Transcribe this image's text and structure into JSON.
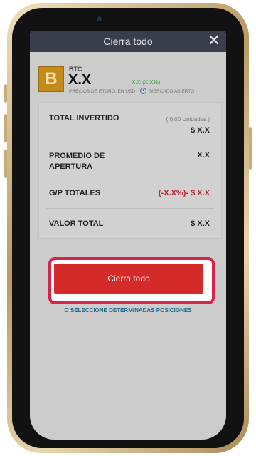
{
  "header": {
    "title": "Cierra todo",
    "close_icon": "close-icon"
  },
  "asset": {
    "symbol": "BTC",
    "logo_letter": "B",
    "price": "X.X",
    "change": "X.X (X.X%)",
    "note_prices": "PRECIOS DE ETORO, EN USD",
    "note_separator": "|",
    "note_market": "MERCADO ABIERTO",
    "logo_color": "#c48a1a"
  },
  "summary": {
    "total_invested_label": "TOTAL INVERTIDO",
    "units": "( 0.00 Unidades )",
    "total_invested_value": "$ X.X",
    "avg_open_label": "PROMEDIO DE APERTURA",
    "avg_open_value": "X.X",
    "pl_label": "G/P TOTALES",
    "pl_value": "(-X.X%)- $ X.X",
    "total_value_label": "VALOR TOTAL",
    "total_value_value": "$ X.X"
  },
  "actions": {
    "close_all_label": "Cierra todo",
    "select_positions_label": "O SELECCIONE DETERMINADAS POSICIONES",
    "accent": "#d42a2a"
  }
}
